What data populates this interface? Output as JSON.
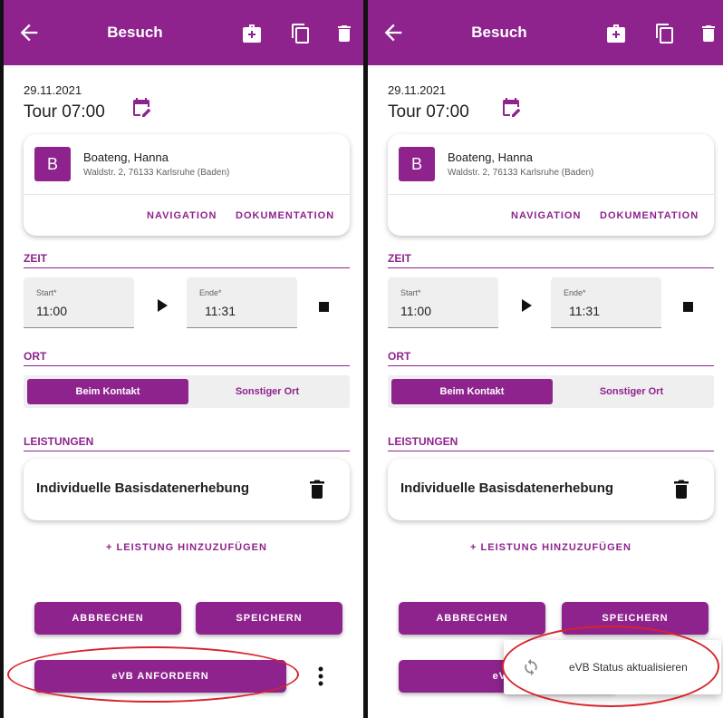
{
  "header": {
    "title": "Besuch"
  },
  "visit": {
    "date": "29.11.2021",
    "tour": "Tour 07:00"
  },
  "patient": {
    "initial": "B",
    "name": "Boateng, Hanna",
    "address": "Waldstr. 2, 76133 Karlsruhe (Baden)",
    "actions": [
      "NAVIGATION",
      "DOKUMENTATION"
    ]
  },
  "zeit": {
    "section": "ZEIT",
    "start_label": "Start*",
    "start_value": "11:00",
    "end_label": "Ende*",
    "end_value": "11:31"
  },
  "ort": {
    "section": "ORT",
    "options": [
      "Beim Kontakt",
      "Sonstiger Ort"
    ],
    "selected": "Beim Kontakt"
  },
  "leistungen": {
    "section": "LEISTUNGEN",
    "items": [
      "Individuelle Basisdatenerhebung"
    ],
    "add_label": "+ LEISTUNG HINZUZUFÜGEN"
  },
  "buttons": {
    "cancel": "ABBRECHEN",
    "save": "SPEICHERN",
    "evb": "eVB ANFORDERN",
    "evb_partial": "eVB"
  },
  "menu": {
    "items": [
      "eVB Status aktualisieren"
    ]
  },
  "colors": {
    "brand": "#8e238d",
    "highlight": "#d8232a"
  },
  "icons": [
    "arrow-left-icon",
    "medical-bag-icon",
    "copy-icon",
    "trash-icon",
    "calendar-edit-icon",
    "play-icon",
    "stop-icon",
    "more-vert-icon",
    "sync-icon"
  ]
}
